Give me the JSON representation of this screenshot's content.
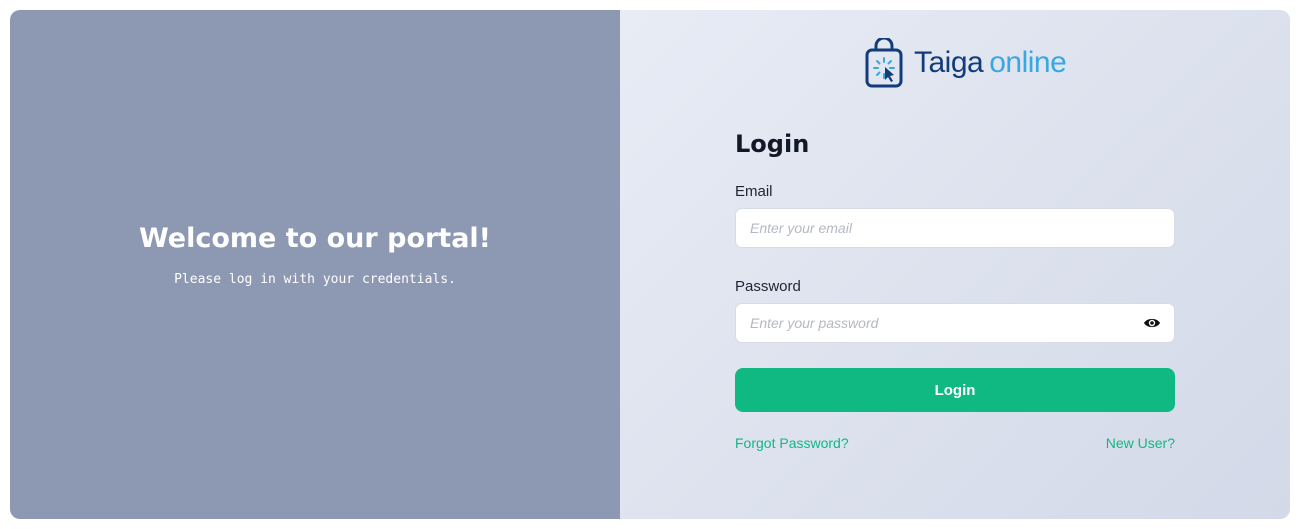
{
  "welcome": {
    "title": "Welcome to our portal!",
    "subtitle": "Please log in with your credentials."
  },
  "brand": {
    "name_primary": "Taiga",
    "name_secondary": "online",
    "logo_icon": "shopping-bag-cursor-icon"
  },
  "form": {
    "title": "Login",
    "email_label": "Email",
    "email_placeholder": "Enter your email",
    "email_value": "",
    "password_label": "Password",
    "password_placeholder": "Enter your password",
    "password_value": "",
    "password_toggle_icon": "eye-icon",
    "submit_label": "Login",
    "forgot_link": "Forgot Password?",
    "new_user_link": "New User?"
  },
  "colors": {
    "left_panel": "#8d98b3",
    "accent": "#10b981",
    "brand_dark": "#123c7a",
    "brand_light": "#37a8e2"
  }
}
